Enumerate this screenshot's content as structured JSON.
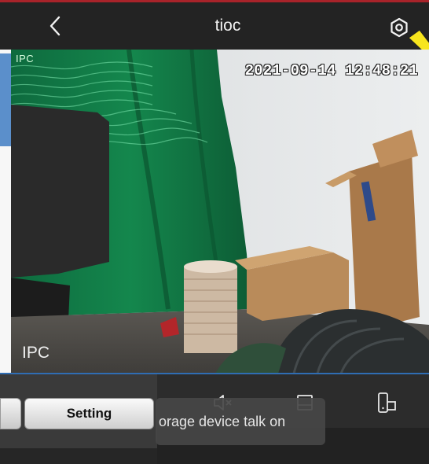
{
  "header": {
    "title": "tioc",
    "back_icon": "chevron-left-icon",
    "settings_icon": "settings-gear-icon"
  },
  "video": {
    "timestamp": "2021-09-14 12:48:21",
    "label_top": "IPC",
    "label_bottom": "IPC"
  },
  "toolbar": {
    "setting_label": "Setting",
    "tooltip_text": "orage device talk on"
  },
  "controls": {
    "icons": [
      "mute-speaker-icon",
      "snapshot-icon",
      "device-icon"
    ]
  },
  "colors": {
    "top_accent": "#a8232a",
    "divider_blue": "#2f6db3",
    "callout_yellow": "#f7e51d"
  }
}
